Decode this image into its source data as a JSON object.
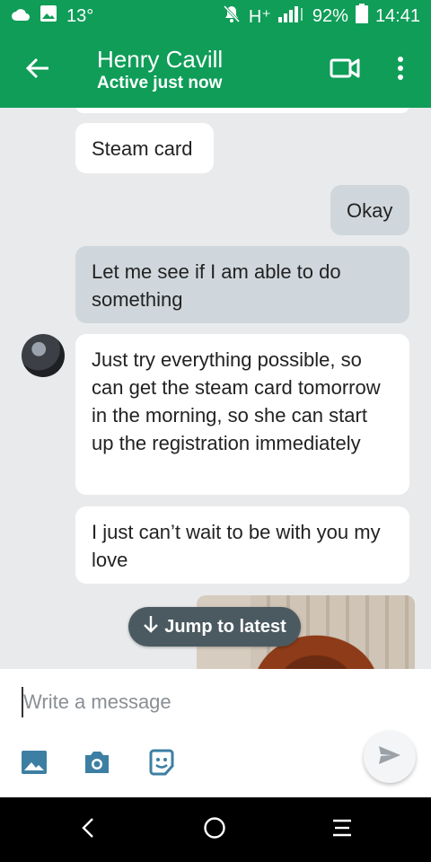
{
  "status_bar": {
    "temperature": "13°",
    "network": "H⁺",
    "battery": "92%",
    "time": "14:41"
  },
  "app_bar": {
    "contact_name": "Henry Cavill",
    "contact_status": "Active just now"
  },
  "messages": [
    {
      "text": "Steam card",
      "direction": "in"
    },
    {
      "text": "Okay",
      "direction": "out"
    },
    {
      "text": "Let me see if I am able to do something",
      "direction": "out"
    },
    {
      "text": "Just try everything possible, so can get the steam card tomorrow in the morning, so she can start up the registration immediately",
      "direction": "in"
    },
    {
      "text": "I just can’t wait to be with you my love",
      "direction": "in"
    }
  ],
  "jump_to_latest": "Jump to latest",
  "composer": {
    "placeholder": "Write a message"
  },
  "colors": {
    "brand_green": "#0f9d58",
    "incoming_bubble": "#ffffff",
    "outgoing_bubble": "#cfd7dc",
    "chat_background": "#e9eaec"
  },
  "icons": {
    "status": [
      "cloud-icon",
      "image-icon",
      "mute-icon",
      "signal-icon",
      "battery-icon"
    ],
    "app_bar": [
      "back-arrow-icon",
      "video-camera-icon",
      "more-vert-icon"
    ],
    "composer": [
      "gallery-icon",
      "camera-icon",
      "sticker-icon",
      "send-icon"
    ],
    "nav": [
      "nav-back-icon",
      "nav-home-icon",
      "nav-recents-icon"
    ]
  }
}
